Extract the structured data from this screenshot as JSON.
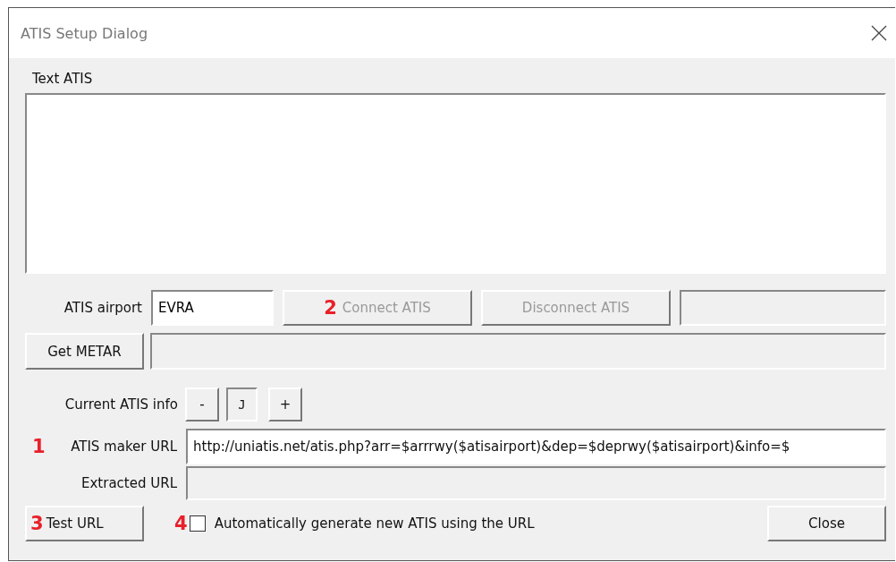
{
  "window": {
    "title": "ATIS Setup Dialog"
  },
  "text_atis": {
    "label": "Text ATIS"
  },
  "airport": {
    "label": "ATIS airport",
    "value": "EVRA"
  },
  "connection_buttons": [
    {
      "label": "Connect ATIS",
      "marker": "2",
      "disabled": true
    },
    {
      "label": "Disconnect ATIS",
      "disabled": true
    }
  ],
  "metar": {
    "button": "Get METAR"
  },
  "current_info": {
    "label": "Current ATIS info",
    "decrement": "-",
    "value": "J",
    "increment": "+"
  },
  "maker_url": {
    "marker": "1",
    "label": "ATIS maker URL",
    "value": "http://uniatis.net/atis.php?arr=$arrrwy($atisairport)&dep=$deprwy($atisairport)&info=$"
  },
  "extracted_url": {
    "label": "Extracted URL"
  },
  "test_button": {
    "marker": "3",
    "label": "Test URL"
  },
  "auto_generate": {
    "marker": "4",
    "label": "Automatically generate new ATIS using the URL",
    "checked": false
  },
  "close_button": {
    "label": "Close"
  }
}
